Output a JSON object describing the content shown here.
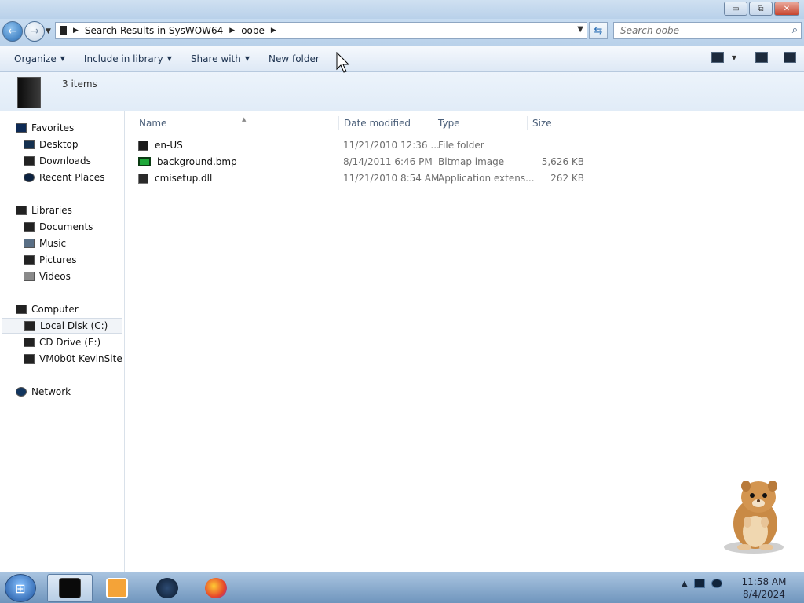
{
  "window": {
    "buttons": {
      "minimize": "▭",
      "maximize": "⧉",
      "close": "✕"
    }
  },
  "address": {
    "crumbs": [
      "Search Results in SysWOW64",
      "oobe"
    ],
    "search_placeholder": "Search oobe"
  },
  "toolbar": {
    "organize": "Organize",
    "include_in_library": "Include in library",
    "share_with": "Share with",
    "new_folder": "New folder"
  },
  "details": {
    "item_count": "3 items"
  },
  "nav": {
    "favorites": "Favorites",
    "desktop": "Desktop",
    "downloads": "Downloads",
    "recent_places": "Recent Places",
    "libraries": "Libraries",
    "documents": "Documents",
    "music": "Music",
    "pictures": "Pictures",
    "videos": "Videos",
    "computer": "Computer",
    "local_disk": "Local Disk (C:)",
    "cd_drive": "CD Drive (E:)",
    "network_share": "VM0b0t KevinSite",
    "network": "Network"
  },
  "columns": {
    "name": "Name",
    "date_modified": "Date modified",
    "type": "Type",
    "size": "Size"
  },
  "files": [
    {
      "name": "en-US",
      "date": "11/21/2010 12:36 ...",
      "type": "File folder",
      "size": ""
    },
    {
      "name": "background.bmp",
      "date": "8/14/2011 6:46 PM",
      "type": "Bitmap image",
      "size": "5,626 KB"
    },
    {
      "name": "cmisetup.dll",
      "date": "11/21/2010 8:54 AM",
      "type": "Application extens...",
      "size": "262 KB"
    }
  ],
  "taskbar": {
    "time": "11:58 AM",
    "date": "8/4/2024"
  },
  "colors": {
    "accent": "#2a6eb5",
    "taskbar": "#6f95bd",
    "bitmap_icon": "#1fa83a"
  }
}
